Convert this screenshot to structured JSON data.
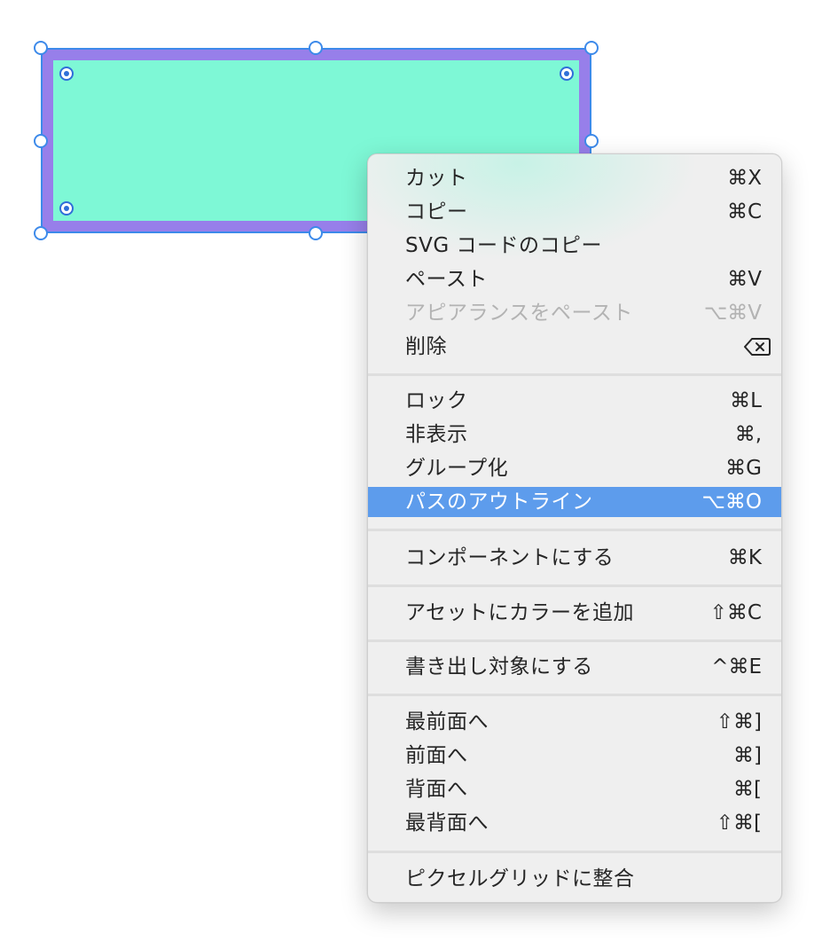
{
  "canvas": {
    "shape_fill": "#7ef8d6",
    "shape_stroke": "#977fea",
    "selection_color": "#3d8aea"
  },
  "menu": {
    "highlight_color": "#5d9cec",
    "items": [
      {
        "label": "カット",
        "shortcut": "⌘X"
      },
      {
        "label": "コピー",
        "shortcut": "⌘C"
      },
      {
        "label": "SVG コードのコピー",
        "shortcut": ""
      },
      {
        "label": "ペースト",
        "shortcut": "⌘V"
      },
      {
        "label": "アピアランスをペースト",
        "shortcut": "⌥⌘V",
        "disabled": true
      },
      {
        "label": "削除",
        "shortcut_icon": "delete-backward-icon"
      },
      {
        "label": "ロック",
        "shortcut": "⌘L"
      },
      {
        "label": "非表示",
        "shortcut": "⌘,"
      },
      {
        "label": "グループ化",
        "shortcut": "⌘G"
      },
      {
        "label": "パスのアウトライン",
        "shortcut": "⌥⌘O",
        "highlighted": true
      },
      {
        "label": "コンポーネントにする",
        "shortcut": "⌘K"
      },
      {
        "label": "アセットにカラーを追加",
        "shortcut": "⇧⌘C"
      },
      {
        "label": "書き出し対象にする",
        "shortcut": "^⌘E"
      },
      {
        "label": "最前面へ",
        "shortcut": "⇧⌘]"
      },
      {
        "label": "前面へ",
        "shortcut": "⌘]"
      },
      {
        "label": "背面へ",
        "shortcut": "⌘["
      },
      {
        "label": "最背面へ",
        "shortcut": "⇧⌘["
      },
      {
        "label": "ピクセルグリッドに整合",
        "shortcut": ""
      }
    ]
  }
}
